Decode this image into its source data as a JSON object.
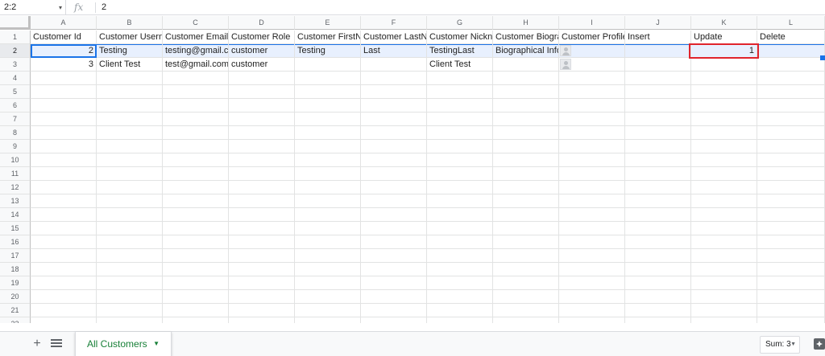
{
  "formula_bar": {
    "name_box": "2:2",
    "fx": "fx",
    "value": "2"
  },
  "columns": [
    "A",
    "B",
    "C",
    "D",
    "E",
    "F",
    "G",
    "H",
    "I",
    "J",
    "K",
    "L"
  ],
  "rows": [
    "1",
    "2",
    "3",
    "4",
    "5",
    "6",
    "7",
    "8",
    "9",
    "10",
    "11",
    "12",
    "13",
    "14",
    "15",
    "16",
    "17",
    "18",
    "19",
    "20",
    "21",
    "22"
  ],
  "header_row": [
    "Customer Id",
    "Customer Usern",
    "Customer Emaill",
    "Customer Role",
    "Customer FirstN",
    "Customer LastNa",
    "Customer Nickna",
    "Customer Biogra",
    "Customer Profile",
    "Insert",
    "Update",
    "Delete"
  ],
  "data_rows": [
    {
      "id": "2",
      "username": "Testing",
      "email": "testing@gmail.co",
      "role": "customer",
      "first": "Testing",
      "last": "Last",
      "nickname": "TestingLast",
      "bio": "Biographical Info",
      "update": "1"
    },
    {
      "id": "3",
      "username": "Client Test",
      "email": "test@gmail.com",
      "role": "customer",
      "first": "",
      "last": "",
      "nickname": "Client Test",
      "bio": "",
      "update": ""
    }
  ],
  "sheet_bar": {
    "add": "+",
    "tab_label": "All Customers",
    "sum": "Sum: 3"
  },
  "colors": {
    "accent": "#1a73e8",
    "tab_green": "#188038",
    "highlight": "#e8f0fe",
    "annotation_red": "#e0242c"
  },
  "icons": [
    "fx-icon",
    "add-sheet-icon",
    "sheets-list-icon",
    "dropdown-caret-icon",
    "explore-icon",
    "avatar-placeholder-icon"
  ]
}
